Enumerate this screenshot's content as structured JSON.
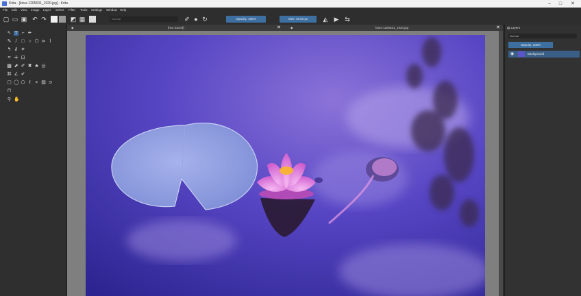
{
  "window": {
    "title": "Krita - [lotus-1205631_1920.jpg] - Krita",
    "controls": [
      "–",
      "□",
      "✕"
    ]
  },
  "menu": [
    "File",
    "Edit",
    "View",
    "Image",
    "Layer",
    "Select",
    "Filter",
    "Tools",
    "Settings",
    "Window",
    "Help"
  ],
  "toolbar": {
    "blend_mode_placeholder": "Normal",
    "opacity_label": "Opacity: 100%",
    "size_label": "Size: 40.00 px"
  },
  "tabs": {
    "left_title": "[Not Saved]",
    "right_title": "lotus-1205631_1920.jpg"
  },
  "layers_docker": {
    "title": "Layers",
    "blend_mode": "Normal",
    "opacity": "Opacity: 100%",
    "layer_name": "Background"
  },
  "colors": {
    "accent": "#3d6fa0",
    "water_dark": "#2c2490",
    "water_light": "#8b73d8",
    "lily_pad": "#8d9fe0",
    "lotus": "#e78ce6"
  }
}
